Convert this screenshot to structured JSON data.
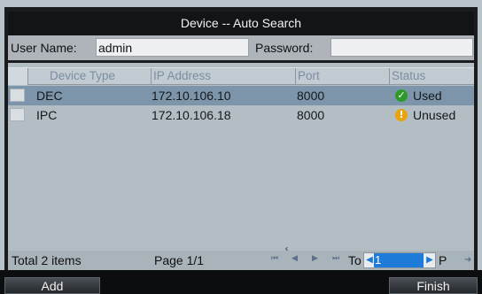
{
  "dialog": {
    "title": "Device -- Auto Search"
  },
  "credentials": {
    "user_label": "User Name:",
    "user_value": "admin",
    "password_label": "Password:",
    "password_value": ""
  },
  "table": {
    "columns": [
      "Device Type",
      "IP Address",
      "Port",
      "Status"
    ],
    "rows": [
      {
        "type": "DEC",
        "ip": "172.10.106.10",
        "port": "8000",
        "status": "Used",
        "status_icon": "check-circle-icon",
        "selected": true
      },
      {
        "type": "IPC",
        "ip": "172.10.106.18",
        "port": "8000",
        "status": "Unused",
        "status_icon": "warning-circle-icon",
        "selected": false
      }
    ]
  },
  "footer": {
    "total": "Total 2 items",
    "page": "Page 1/1",
    "to_label": "To",
    "page_input": "1",
    "p_label": "P"
  },
  "buttons": {
    "add": "Add",
    "finish": "Finish"
  },
  "colors": {
    "title_bg": "#121416",
    "selected_row": "#7d95ab",
    "used_icon": "#2e9a2a",
    "unused_icon": "#e9a30c",
    "spinner_highlight": "#1f7bd8"
  }
}
